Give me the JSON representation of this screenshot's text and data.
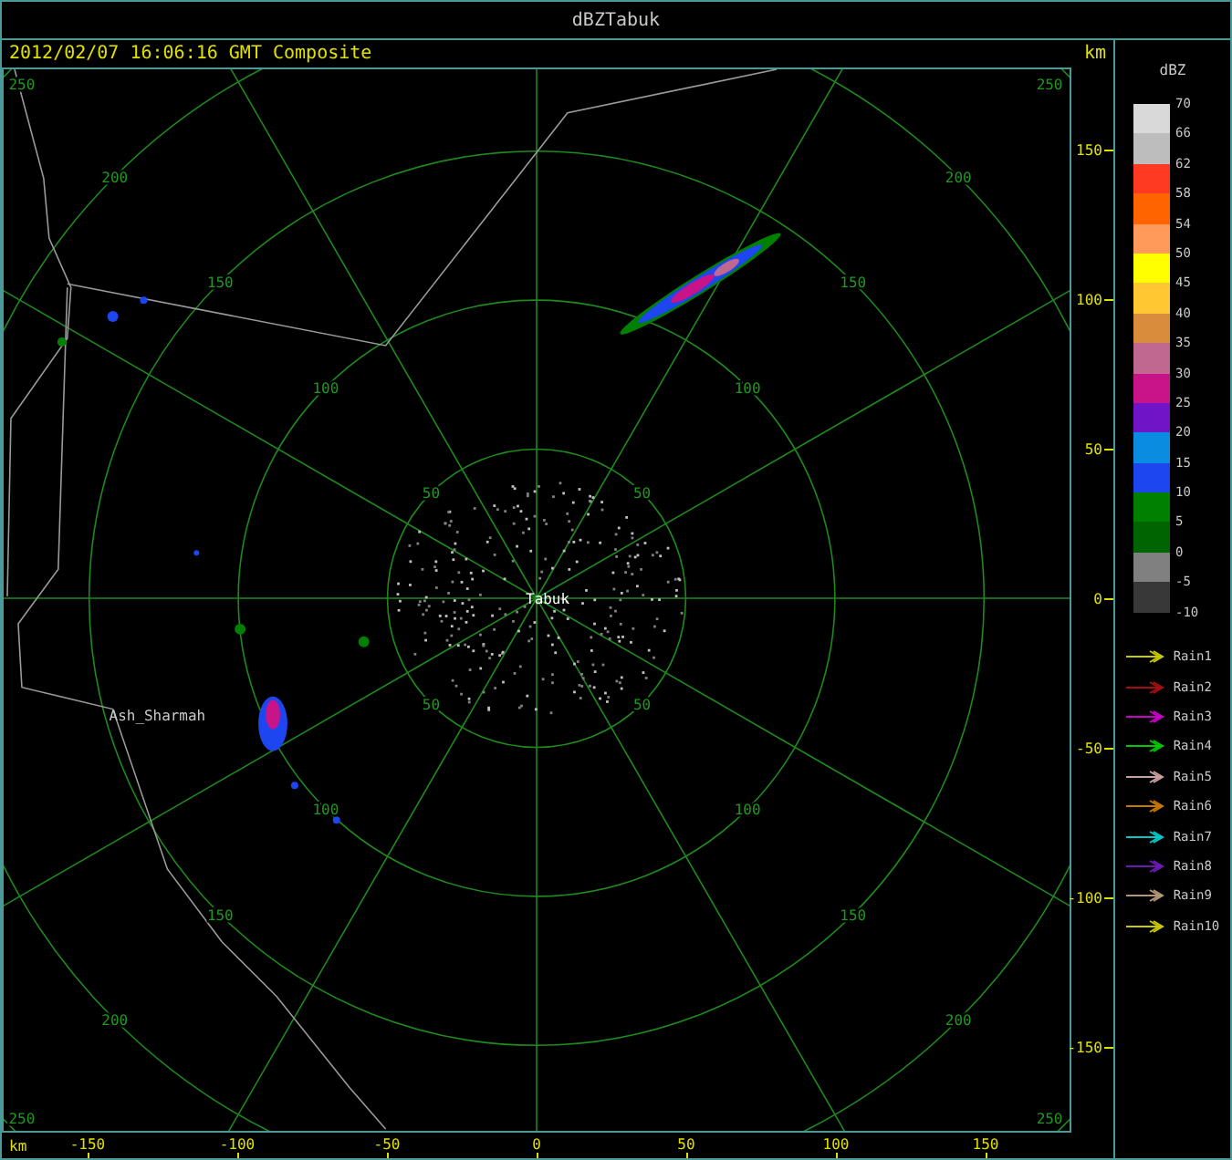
{
  "window": {
    "title": "dBZTabuk"
  },
  "header": {
    "timestamp": "2012/02/07 16:06:16 GMT Composite",
    "unit": "km"
  },
  "map": {
    "station": "Tabuk",
    "place": "Ash_Sharmah",
    "rings": [
      {
        "labels": [
          "50",
          "50",
          "50",
          "50"
        ]
      },
      {
        "labels": [
          "100",
          "100",
          "100",
          "100"
        ]
      },
      {
        "labels": [
          "150",
          "150",
          "150",
          "150"
        ]
      },
      {
        "labels": [
          "200",
          "200",
          "200",
          "200"
        ]
      },
      {
        "labels": [
          "250",
          "250",
          "250",
          "250"
        ]
      }
    ]
  },
  "y_axis": {
    "ticks": [
      "150",
      "100",
      "50",
      "0",
      "-50",
      "-100",
      "-150"
    ]
  },
  "x_axis": {
    "unit": "km",
    "ticks": [
      "-150",
      "-100",
      "-50",
      "0",
      "50",
      "100",
      "150"
    ]
  },
  "legend": {
    "title": "dBZ",
    "labels": [
      "70",
      "66",
      "62",
      "58",
      "54",
      "50",
      "45",
      "40",
      "35",
      "30",
      "25",
      "20",
      "15",
      "10",
      "5",
      "0",
      "-5",
      "-10"
    ],
    "bands": [
      {
        "color": "#d9d9d9"
      },
      {
        "color": "#bdbdbd"
      },
      {
        "color": "#ff3a22"
      },
      {
        "color": "#ff6400"
      },
      {
        "color": "#ff9a5a"
      },
      {
        "color": "#ffff00"
      },
      {
        "color": "#ffc832"
      },
      {
        "color": "#d88c3c"
      },
      {
        "color": "#c06890"
      },
      {
        "color": "#c81488"
      },
      {
        "color": "#7014c8"
      },
      {
        "color": "#0a8ce0"
      },
      {
        "color": "#1e46f0"
      },
      {
        "color": "#008000"
      },
      {
        "color": "#006400"
      },
      {
        "color": "#808080"
      },
      {
        "color": "#383838"
      }
    ],
    "tracks": [
      {
        "label": "Rain1",
        "color": "#c8c800"
      },
      {
        "label": "Rain2",
        "color": "#a01010"
      },
      {
        "label": "Rain3",
        "color": "#c800c8"
      },
      {
        "label": "Rain4",
        "color": "#00c800"
      },
      {
        "label": "Rain5",
        "color": "#c8a0a0"
      },
      {
        "label": "Rain6",
        "color": "#c87800"
      },
      {
        "label": "Rain7",
        "color": "#00c8c8"
      },
      {
        "label": "Rain8",
        "color": "#6a1ab0"
      },
      {
        "label": "Rain9",
        "color": "#b49678"
      },
      {
        "label": "Rain10",
        "color": "#c8c800"
      }
    ]
  }
}
